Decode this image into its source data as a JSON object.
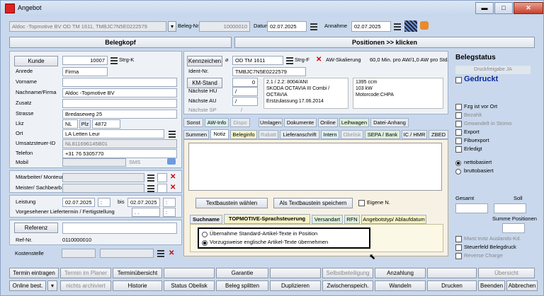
{
  "window": {
    "title": "Angebot",
    "min": "▬",
    "max": "□",
    "close": "✕"
  },
  "top": {
    "summary": "Aldoc -Topmotive BV OD TM 1611, TMBJC7N5E0222579",
    "beleg_nr_label": "Beleg-Nr",
    "beleg_nr": "10000010",
    "datum_label": "Datum",
    "datum": "02.07.2025",
    "annahme_label": "Annahme",
    "annahme": "02.07.2025"
  },
  "headers": {
    "belegkopf": "Belegkopf",
    "positionen": "Positionen >> klicken"
  },
  "customer": {
    "kunde_btn": "Kunde",
    "kunde_nr": "10007",
    "strg": "Strg-K",
    "anrede_label": "Anrede",
    "anrede": "Firma",
    "vorname_label": "Vorname",
    "vorname": "",
    "nachname_label": "Nachname/Firma",
    "nachname": "Aldoc -Topmotive BV",
    "zusatz_label": "Zusatz",
    "zusatz": "",
    "strasse_label": "Strasse",
    "strasse": "Bredaseweg 25",
    "lkz_label": "Lkz",
    "lkz": "NL",
    "plz_label": "Plz",
    "plz": "4872",
    "ort_label": "Ort",
    "ort": "LA Letten Leur",
    "ust_label": "Umsatzsteuer-ID",
    "ust": "NL811696145B01",
    "telefon_label": "Telefon",
    "telefon": "+31 76 5305770",
    "mobil_label": "Mobil",
    "mobil": "",
    "sms": "SMS"
  },
  "staff": {
    "mitarbeiter_label": "Mitarbeiter/ Monteur",
    "meister_label": "Meister/ Sachbearb."
  },
  "leistung": {
    "label": "Leistung",
    "from": "02.07.2025",
    "bis_label": "bis",
    "to": "02.07.2025",
    "termin_label": "Vorgesehener Liefertermin / Fertigstellung",
    "termin": ". ."
  },
  "referenz": {
    "btn": "Referenz",
    "value": "",
    "refnr_label": "Ref-Nr.",
    "refnr": "0110000010"
  },
  "kostenstelle": {
    "label": "Kostenstelle"
  },
  "vehicle": {
    "kennzeichen_btn": "Kennzeichen",
    "kennzeichen": "OD TM 1611",
    "strg": "Strg-F",
    "aw_label": "AW-Skalierung",
    "aw": "60,0 Min. pro AW/1,0 AW pro Std.",
    "ident_label": "Ident-Nr.",
    "ident": "TMBJC7N5E0222579",
    "km_btn": "KM-Stand",
    "km": "0",
    "hu_label": "Nächste HU",
    "hu": "/",
    "au_label": "Nächste AU",
    "au": "/",
    "sp_label": "Nächste SP",
    "sp": "/",
    "desc": [
      "2.1 / 2.2: 8004/ANI",
      "SKODA OCTAVIA III Combi / OCTAVIA",
      "Erstzulassung 17.06.2014"
    ],
    "tech": [
      "1395 ccm",
      "103 kW",
      "Motorcode:CHPA"
    ]
  },
  "tabs1": [
    "Sonst",
    "AW-Info",
    "Dispo",
    "Umlagen",
    "Dokumente",
    "Online",
    "Leihwagen",
    "Datei-Anhang"
  ],
  "tabs2": [
    "Summen",
    "Notiz",
    "Beleginfo",
    "Rabatt",
    "Lieferanschrift",
    "Intern",
    "Obelisk",
    "SEPA / Bank",
    "IC / HMR",
    "ZBED"
  ],
  "textbaustein": {
    "waehlen": "Textbaustein wählen",
    "speichern": "Als Textbaustein speichern",
    "eigene": "Eigene N."
  },
  "tabs3": [
    "Suchname",
    "TOPMOTIVE-Sprachsteuerung",
    "Versandart",
    "RFN",
    "Angebotstyp/ Ablaufdatum"
  ],
  "options": [
    "Übernahme Standard-Artikel-Texte in Position",
    "Vorzugsweise englische Artikel-Texte übernehmen"
  ],
  "status": {
    "title": "Belegstatus",
    "druck": "Druckfreigabe JA",
    "gedruckt": "Gedruckt",
    "checks": [
      "Fzg ist vor Ort",
      "Bezahlt",
      "Gewandelt in Stomo",
      "Export",
      "Fibuexport",
      "Erledigt"
    ],
    "radios": [
      "nettobasiert",
      "bruttobasiert"
    ],
    "gesamt": "Gesamt",
    "soll": "Soll",
    "summe_pos": "Summe Positionen",
    "checks2": [
      "Mwst trotz Auslands-Kd.",
      "Steuerfeld Belegdruck",
      "Reverse Charge"
    ]
  },
  "bottom_row1": [
    "Termin eintragen",
    "Termin im Planer",
    "Terminübersicht",
    "",
    "Garantie",
    "",
    "Selbstbeteiligung",
    "Anzahlung",
    "",
    "Übersicht"
  ],
  "bottom_row2": [
    "Online best.",
    "nichts archiviert",
    "Historie",
    "Status Obelisk",
    "Beleg splitten",
    "Duplizieren",
    "Zwischenspeich.",
    "Wandeln",
    "Drucken",
    "Beenden",
    "Abbrechen"
  ]
}
